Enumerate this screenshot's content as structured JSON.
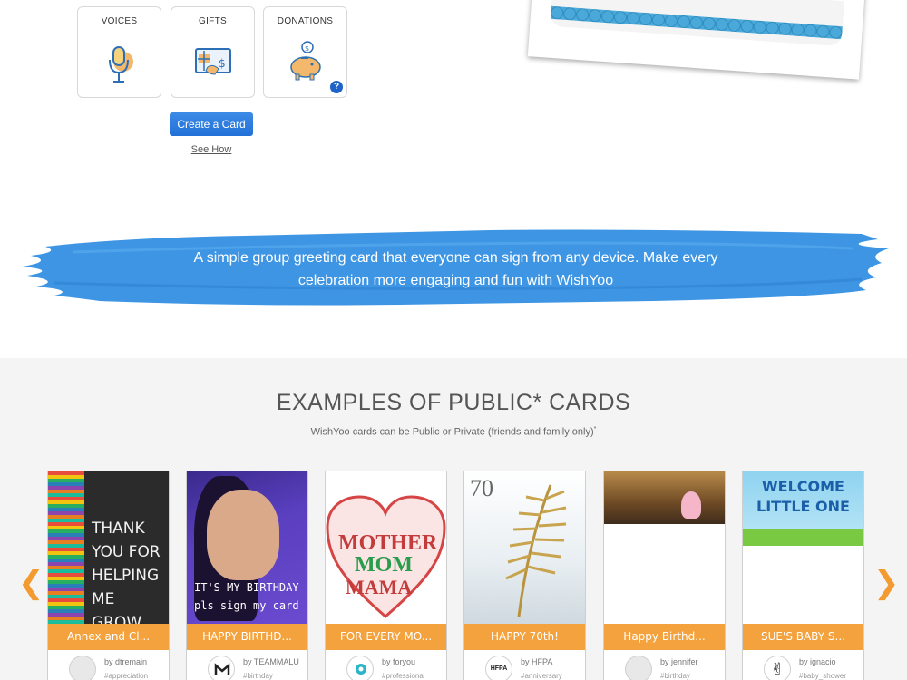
{
  "features": {
    "voices": "VOICES",
    "gifts": "GIFTS",
    "donations": "DONATIONS",
    "help_badge": "?"
  },
  "actions": {
    "create_card": "Create a Card",
    "see_how": "See How"
  },
  "banner": {
    "text": "A simple group greeting card that everyone can sign from any device. Make every celebration more engaging and fun with WishYoo"
  },
  "examples": {
    "title": "EXAMPLES OF PUBLIC* CARDS",
    "subtitle": "WishYoo cards can be Public or Private (friends and family only)",
    "subtitle_mark": "*",
    "prev_icon": "chevron-left-icon",
    "next_icon": "chevron-right-icon",
    "cards": [
      {
        "art_text": "THANK YOU FOR HELPING ME GROW",
        "caption": "Annex and Cl...",
        "by": "by dtremain",
        "tag": "#appreciation"
      },
      {
        "art_text": "IT'S MY BIRTHDAY pls sign my card",
        "caption": "HAPPY BIRTHD...",
        "by": "by TEAMMALU",
        "tag": "#birthday"
      },
      {
        "art_words": [
          "MOTHER",
          "MOM",
          "MAMA"
        ],
        "caption": "FOR EVERY MO...",
        "by": "by foryou",
        "tag": "#professional"
      },
      {
        "art_text": "70",
        "caption": "HAPPY 70th!",
        "by": "by HFPA",
        "tag": "#anniversary",
        "avatar_text": "HFPA"
      },
      {
        "caption": "Happy Birthd...",
        "by": "by jennifer",
        "tag": "#birthday"
      },
      {
        "art_text": "WELCOME LITTLE ONE",
        "caption": "SUE'S BABY S...",
        "by": "by ignacio",
        "tag": "#baby_shower"
      }
    ]
  },
  "colors": {
    "accent_orange": "#f3a23d",
    "button_blue": "#2271d8",
    "banner_blue": "#3d95e3"
  }
}
